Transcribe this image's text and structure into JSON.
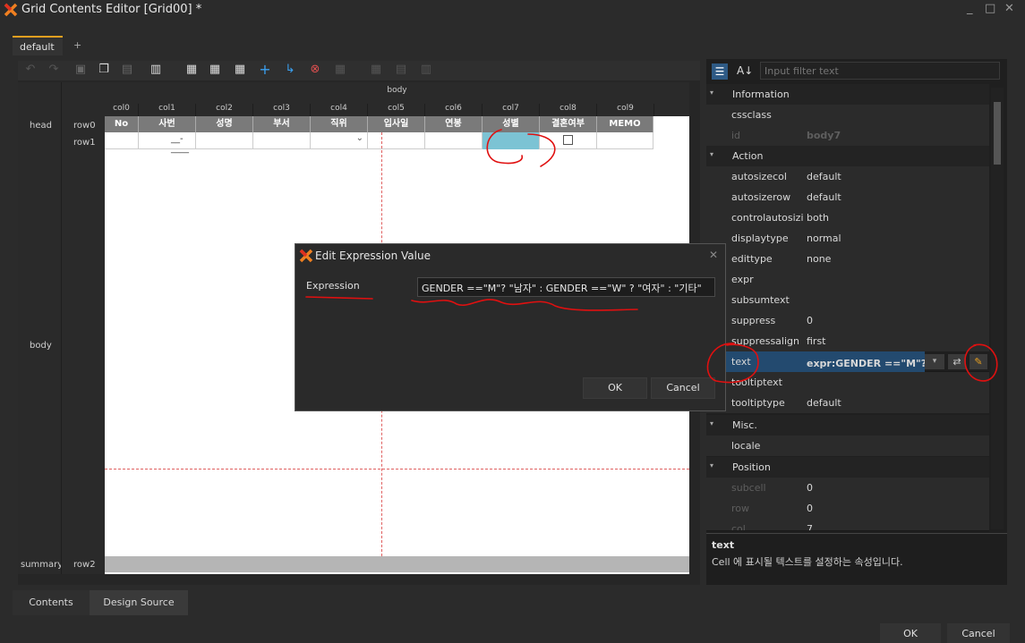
{
  "window": {
    "title": "Grid Contents Editor [Grid00] *",
    "minimize": "_",
    "maximize": "□",
    "close": "✕"
  },
  "doc_tabs": [
    {
      "label": "default"
    },
    {
      "label": "+"
    }
  ],
  "grid": {
    "band_head": "head",
    "band_body": "body",
    "band_summary": "summary",
    "body_header": "body",
    "rows": {
      "row0": "row0",
      "row1": "row1",
      "row2": "row2"
    },
    "columns": [
      "col0",
      "col1",
      "col2",
      "col3",
      "col4",
      "col5",
      "col6",
      "col7",
      "col8",
      "col9"
    ],
    "header_cells": [
      "No",
      "사번",
      "성명",
      "부서",
      "직위",
      "입사일",
      "연봉",
      "성별",
      "결혼여부",
      "MEMO"
    ],
    "row1_mask": "__-____"
  },
  "bottom_tabs": [
    {
      "label": "Contents"
    },
    {
      "label": "Design Source"
    }
  ],
  "props": {
    "filter_placeholder": "Input filter text",
    "sort_alpha_icon": "A↓",
    "information": "Information",
    "cssclass": {
      "name": "cssclass",
      "value": ""
    },
    "id": {
      "name": "id",
      "value": "body7"
    },
    "action": "Action",
    "autosizecol": {
      "name": "autosizecol",
      "value": "default"
    },
    "autosizerow": {
      "name": "autosizerow",
      "value": "default"
    },
    "controlautosizin": {
      "name": "controlautosizin",
      "value": "both"
    },
    "displaytype": {
      "name": "displaytype",
      "value": "normal"
    },
    "edittype": {
      "name": "edittype",
      "value": "none"
    },
    "expr": {
      "name": "expr",
      "value": ""
    },
    "subsumtext": {
      "name": "subsumtext",
      "value": ""
    },
    "suppress": {
      "name": "suppress",
      "value": "0"
    },
    "suppressalign": {
      "name": "suppressalign",
      "value": "first"
    },
    "text": {
      "name": "text",
      "value": "expr:GENDER ==\"M\"? \"남"
    },
    "tooltiptext": {
      "name": "tooltiptext",
      "value": ""
    },
    "tooltiptype": {
      "name": "tooltiptype",
      "value": "default"
    },
    "misc": "Misc.",
    "locale": {
      "name": "locale",
      "value": ""
    },
    "position": "Position",
    "subcell": {
      "name": "subcell",
      "value": "0"
    },
    "row": {
      "name": "row",
      "value": "0"
    },
    "col": {
      "name": "col",
      "value": "7"
    },
    "desc_title": "text",
    "desc_text": "Cell 에 표시될 텍스트를 설정하는 속성입니다."
  },
  "dialog": {
    "title": "Edit Expression Value",
    "close": "✕",
    "label": "Expression",
    "value": "GENDER ==\"M\"? \"남자\" : GENDER ==\"W\" ? \"여자\" : \"기타\"",
    "ok": "OK",
    "cancel": "Cancel"
  },
  "footer": {
    "ok": "OK",
    "cancel": "Cancel"
  },
  "colors": {
    "accent": "#e8a020",
    "selection": "#234a6f",
    "annotation": "#e01010",
    "cell_highlight": "#7cc3d4"
  }
}
